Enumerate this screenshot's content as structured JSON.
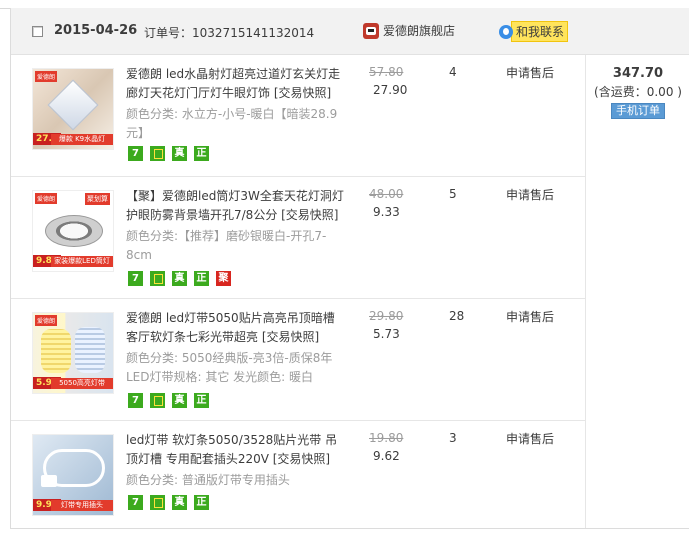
{
  "order": {
    "date": "2015-04-26",
    "order_no_label": "订单号：",
    "order_no": "1032715141132014",
    "shop_name": "爱德朗旗舰店",
    "contact_label": "和我联系"
  },
  "items": [
    {
      "title": "爱德朗 led水晶射灯超亮过道灯玄关灯走廊灯天花灯门厅灯牛眼灯饰 [交易快照]",
      "sku": "颜色分类: 水立方-小号-暖白【暗装28.9元】",
      "orig_price": "57.80",
      "price": "27.90",
      "qty": "4",
      "after_sale": "申请售后",
      "tags": [
        "7",
        "保",
        "真",
        "正"
      ],
      "thumb_badge": "27.8",
      "thumb_banner": "爆款 K9水晶灯"
    },
    {
      "title": "【聚】爱德朗led筒灯3W全套天花灯洞灯护眼防雾背景墙开孔7/8公分 [交易快照]",
      "sku": "颜色分类:【推荐】磨砂银暖白-开孔7-8cm",
      "orig_price": "48.00",
      "price": "9.33",
      "qty": "5",
      "after_sale": "申请售后",
      "tags": [
        "7",
        "保",
        "真",
        "正",
        "聚"
      ],
      "thumb_badge": "9.80",
      "thumb_banner": "家装爆款LED筒灯"
    },
    {
      "title": "爱德朗 led灯带5050贴片高亮吊顶暗槽客厅软灯条七彩光带超亮 [交易快照]",
      "sku": "颜色分类: 5050经典版-亮3倍-质保8年 LED灯带规格: 其它 发光颜色: 暖白",
      "orig_price": "29.80",
      "price": "5.73",
      "qty": "28",
      "after_sale": "申请售后",
      "tags": [
        "7",
        "保",
        "真",
        "正"
      ],
      "thumb_badge": "5.90",
      "thumb_banner": "5050高亮灯带"
    },
    {
      "title": "led灯带 软灯条5050/3528贴片光带 吊顶灯槽 专用配套插头220V [交易快照]",
      "sku": "颜色分类: 普通版灯带专用插头",
      "orig_price": "19.80",
      "price": "9.62",
      "qty": "3",
      "after_sale": "申请售后",
      "tags": [
        "7",
        "保",
        "真",
        "正"
      ],
      "thumb_badge": "9.90",
      "thumb_banner": "灯带专用插头"
    }
  ],
  "summary": {
    "total": "347.70",
    "shipping": "(含运费：0.00 )",
    "mobile_order": "手机订单"
  },
  "colors": {
    "header_bg": "#f2f2f2",
    "contact_bg": "#ffe45c",
    "tag_green": "#3caa1e",
    "tag_red": "#d8261f",
    "mobile_btn": "#5b9bd5"
  }
}
